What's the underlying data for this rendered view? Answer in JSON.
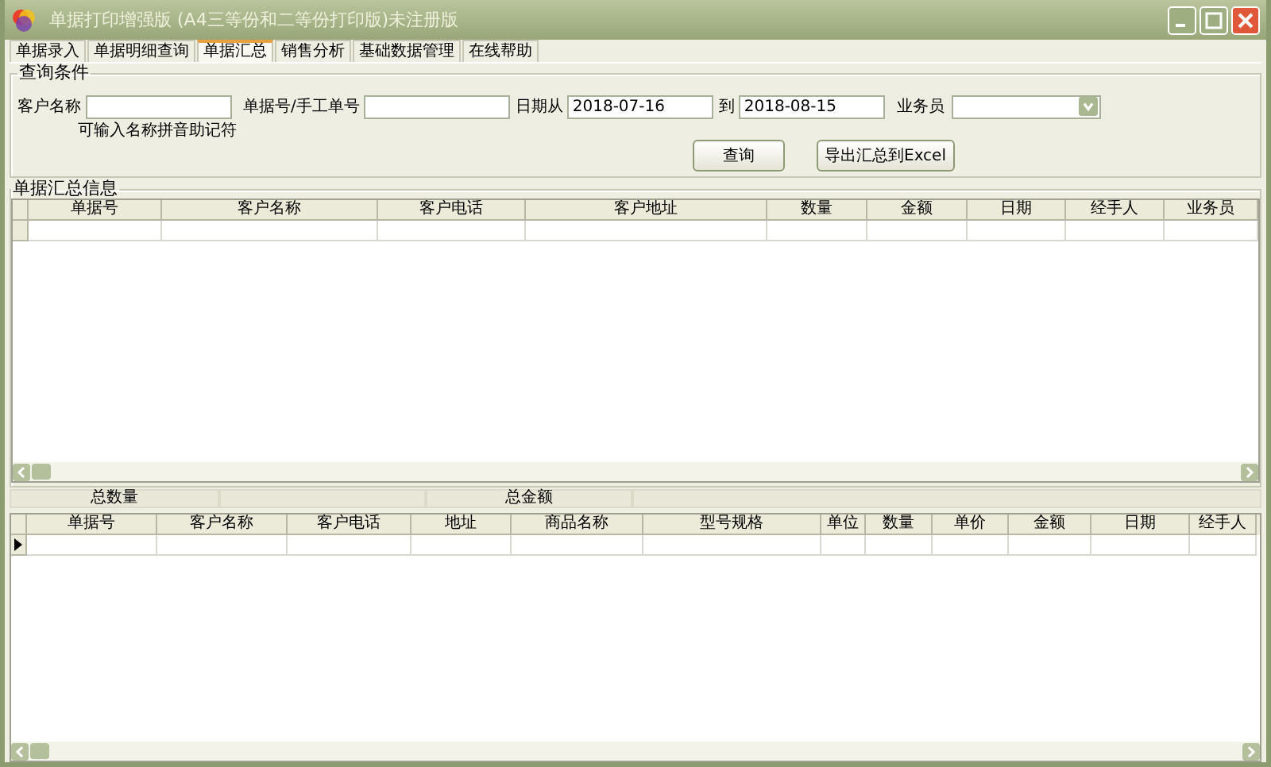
{
  "window": {
    "title": "单据打印增强版 (A4三等份和二等份打印版)未注册版"
  },
  "tabs": [
    {
      "label": "单据录入",
      "selected": false
    },
    {
      "label": "单据明细查询",
      "selected": false
    },
    {
      "label": "单据汇总",
      "selected": true
    },
    {
      "label": "销售分析",
      "selected": false
    },
    {
      "label": "基础数据管理",
      "selected": false
    },
    {
      "label": "在线帮助",
      "selected": false
    }
  ],
  "query": {
    "title": "查询条件",
    "customer_label": "客户名称",
    "customer_hint": "可输入名称拼音助记符",
    "bill_label": "单据号/手工单号",
    "date_from_label": "日期从",
    "date_from": "2018-07-16",
    "date_to_label": "到",
    "date_to": "2018-08-15",
    "salesperson_label": "业务员",
    "search_button": "查询",
    "export_button": "导出汇总到Excel"
  },
  "summary": {
    "title": "单据汇总信息",
    "columns": [
      "单据号",
      "客户名称",
      "客户电话",
      "客户地址",
      "数量",
      "金额",
      "日期",
      "经手人",
      "业务员"
    ],
    "rows": [
      {
        "current": false
      }
    ]
  },
  "totals": {
    "quantity_label": "总数量",
    "amount_label": "总金额"
  },
  "detail": {
    "columns": [
      "单据号",
      "客户名称",
      "客户电话",
      "地址",
      "商品名称",
      "型号规格",
      "单位",
      "数量",
      "单价",
      "金额",
      "日期",
      "经手人"
    ],
    "rows": [
      {
        "current": true
      }
    ]
  }
}
